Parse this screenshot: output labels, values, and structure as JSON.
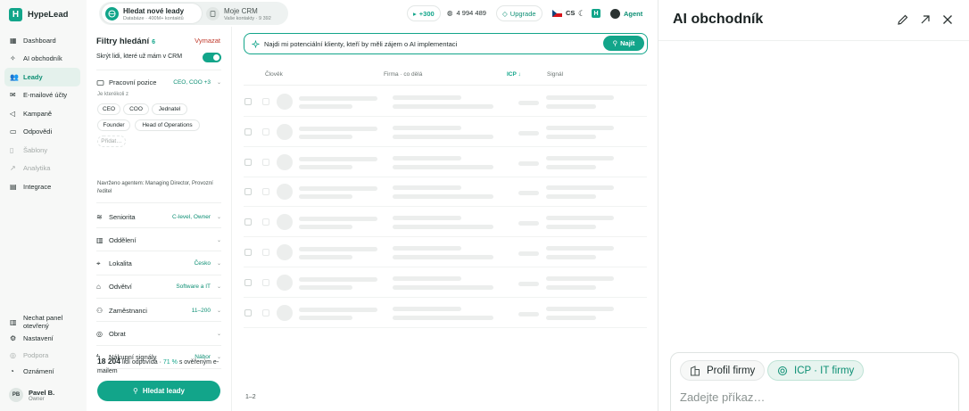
{
  "brand": {
    "name": "HypeLead",
    "logo_letter": "H"
  },
  "nav": [
    {
      "label": "Dashboard",
      "icon": "grid-icon",
      "state": "normal"
    },
    {
      "label": "AI obchodník",
      "icon": "sparkle-icon",
      "state": "normal"
    },
    {
      "label": "Leady",
      "icon": "users-icon",
      "state": "active"
    },
    {
      "label": "E-mailové účty",
      "icon": "mail-icon",
      "state": "normal"
    },
    {
      "label": "Kampaně",
      "icon": "megaphone-icon",
      "state": "normal"
    },
    {
      "label": "Odpovědi",
      "icon": "inbox-icon",
      "state": "normal"
    },
    {
      "label": "Šablony",
      "icon": "file-icon",
      "state": "disabled"
    },
    {
      "label": "Analytika",
      "icon": "chart-icon",
      "state": "disabled"
    },
    {
      "label": "Integrace",
      "icon": "plug-icon",
      "state": "normal"
    }
  ],
  "nav_bottom": [
    {
      "label": "Nechat panel otevřený",
      "icon": "panel-icon",
      "state": "normal"
    },
    {
      "label": "Nastavení",
      "icon": "gear-icon",
      "state": "normal"
    },
    {
      "label": "Podpora",
      "icon": "help-icon",
      "state": "disabled"
    },
    {
      "label": "Oznámení",
      "icon": "bell-icon",
      "state": "normal"
    }
  ],
  "user": {
    "initials": "PB",
    "name": "Pavel B.",
    "role": "Owner"
  },
  "topbar": {
    "seg_active_title": "Hledat nové leady",
    "seg_active_sub": "Databáze · 400M+ kontaktů",
    "seg_inactive_title": "Moje CRM",
    "seg_inactive_sub": "Vaše kontakty · 9 392",
    "credits_add": "+300",
    "credits_count": "4 994 489",
    "upgrade": "Upgrade",
    "language": "CS",
    "agent": "Agent"
  },
  "filters": {
    "title": "Filtry hledání",
    "count": "6",
    "clear": "Vymazat",
    "hide_crm": "Skrýt lidi, které už mám v CRM",
    "hide_crm_on": true,
    "job": {
      "label": "Pracovní pozice",
      "value": "CEO, COO +3"
    },
    "any_of": "Je kterékoli z",
    "chips": [
      "CEO",
      "COO",
      "Jednatel",
      "Founder",
      "Head of Operations"
    ],
    "add_chip": "Přidat…",
    "suggestion": "Navrženo agentem: Managing Director, Provozní ředitel",
    "sections": [
      {
        "label": "Seniorita",
        "value": "C-level, Owner",
        "icon": "layers-icon"
      },
      {
        "label": "Oddělení",
        "value": "",
        "icon": "building-icon"
      },
      {
        "label": "Lokalita",
        "value": "Česko",
        "icon": "pin-icon"
      },
      {
        "label": "Odvětví",
        "value": "Software a IT",
        "icon": "factory-icon"
      },
      {
        "label": "Zaměstnanci",
        "value": "11–200",
        "icon": "team-icon"
      },
      {
        "label": "Obrat",
        "value": "",
        "icon": "coin-icon"
      },
      {
        "label": "Nákupní signály",
        "value": "Nábor",
        "icon": "bolt-icon"
      }
    ],
    "summary_count": "18 204",
    "summary_mid": "lidí odpovídá ·",
    "summary_pct": "71 %",
    "summary_end": "s ověřeným e-mailem",
    "cta": "Hledat leady"
  },
  "main": {
    "search_text": "Najdi mi potenciální klienty, kteří by měli zájem o AI implementaci",
    "search_button": "Najít",
    "columns": [
      "Člověk",
      "Firma · co dělá",
      "ICP",
      "Signál"
    ],
    "sort_arrow": "↓",
    "rows": 8,
    "footer": "1–2"
  },
  "panel": {
    "title": "AI obchodník",
    "chip_company": "Profil firmy",
    "chip_icp": "ICP · IT firmy",
    "placeholder": "Zadejte příkaz…"
  },
  "colors": {
    "accent": "#12a58a",
    "accent_dark": "#0d8f74",
    "danger": "#c0392b"
  }
}
